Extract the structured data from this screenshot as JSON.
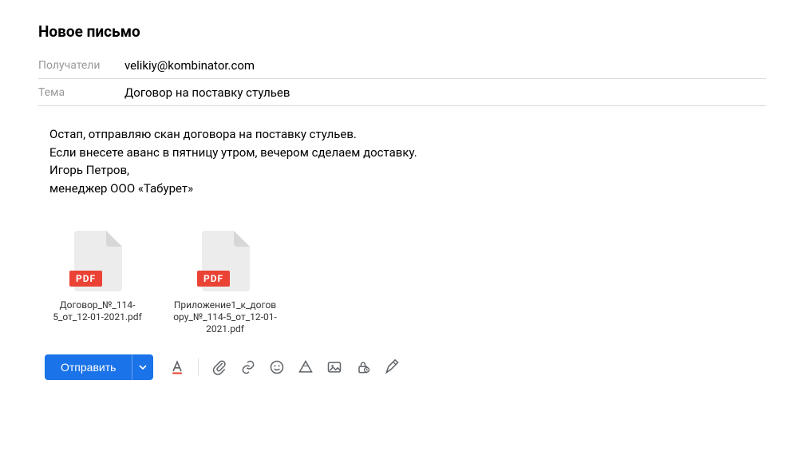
{
  "title": "Новое письмо",
  "fields": {
    "recipients_label": "Получатели",
    "recipients_value": "velikiy@kombinator.com",
    "subject_label": "Тема",
    "subject_value": "Договор на поставку стульев"
  },
  "body": {
    "text": "Остап, отправляю скан договора на поставку стульев.\nЕсли внесете аванс в пятницу утром, вечером сделаем доставку.",
    "signature": "Игорь Петров,\nменеджер ООО «Табурет»"
  },
  "attachments": [
    {
      "badge": "PDF",
      "name": "Договор_№_114-5_от_12-01-2021.pdf"
    },
    {
      "badge": "PDF",
      "name": "Приложение1_к_договору_№_114-5_от_12-01-2021.pdf"
    }
  ],
  "toolbar": {
    "send_label": "Отправить"
  }
}
